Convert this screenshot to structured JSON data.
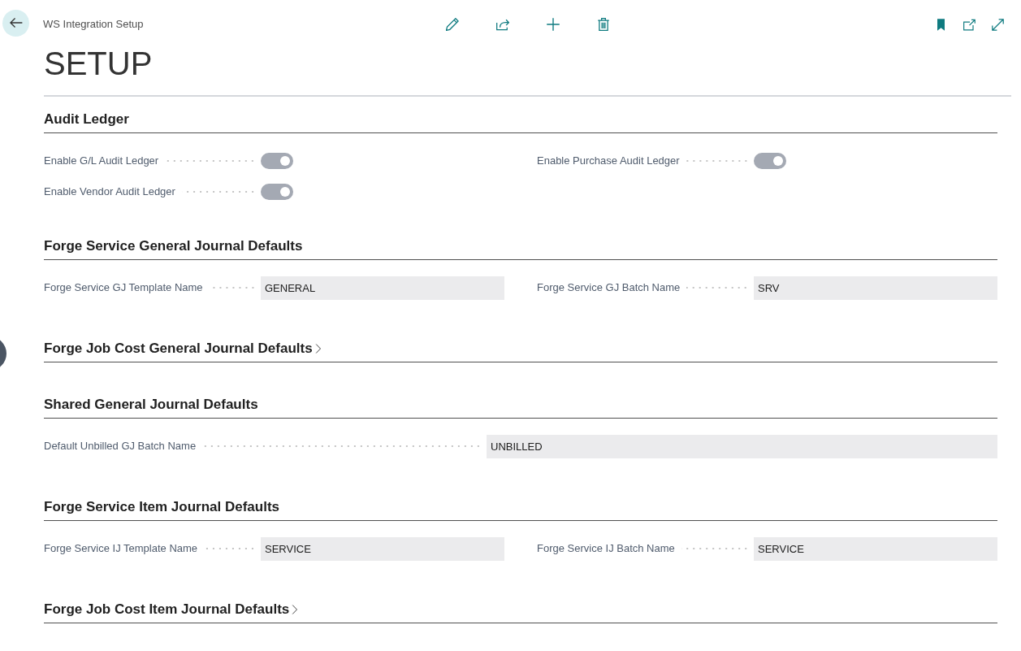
{
  "page": {
    "caption": "WS Integration Setup",
    "title": "SETUP"
  },
  "sections": [
    {
      "title": "Audit Ledger",
      "expanded": true,
      "columns": [
        [
          {
            "kind": "toggle",
            "label": "Enable G/L Audit Ledger",
            "on": true
          },
          {
            "kind": "toggle",
            "label": "Enable Vendor Audit Ledger",
            "on": true
          }
        ],
        [
          {
            "kind": "toggle",
            "label": "Enable Purchase Audit Ledger",
            "on": true
          }
        ]
      ]
    },
    {
      "title": "Forge Service General Journal Defaults",
      "expanded": true,
      "columns": [
        [
          {
            "kind": "text",
            "label": "Forge Service GJ Template Name",
            "value": "GENERAL"
          }
        ],
        [
          {
            "kind": "text",
            "label": "Forge Service GJ Batch Name",
            "value": "SRV"
          }
        ]
      ]
    },
    {
      "title": "Forge Job Cost General Journal Defaults",
      "expanded": false
    },
    {
      "title": "Shared General Journal Defaults",
      "expanded": true,
      "columns": [
        [
          {
            "kind": "text",
            "label": "Default Unbilled GJ Batch Name",
            "value": "UNBILLED"
          }
        ]
      ]
    },
    {
      "title": "Forge Service Item Journal Defaults",
      "expanded": true,
      "columns": [
        [
          {
            "kind": "text",
            "label": "Forge Service IJ Template Name",
            "value": "SERVICE"
          }
        ],
        [
          {
            "kind": "text",
            "label": "Forge Service IJ Batch Name",
            "value": "SERVICE"
          }
        ]
      ]
    },
    {
      "title": "Forge Job Cost Item Journal Defaults",
      "expanded": false
    }
  ]
}
